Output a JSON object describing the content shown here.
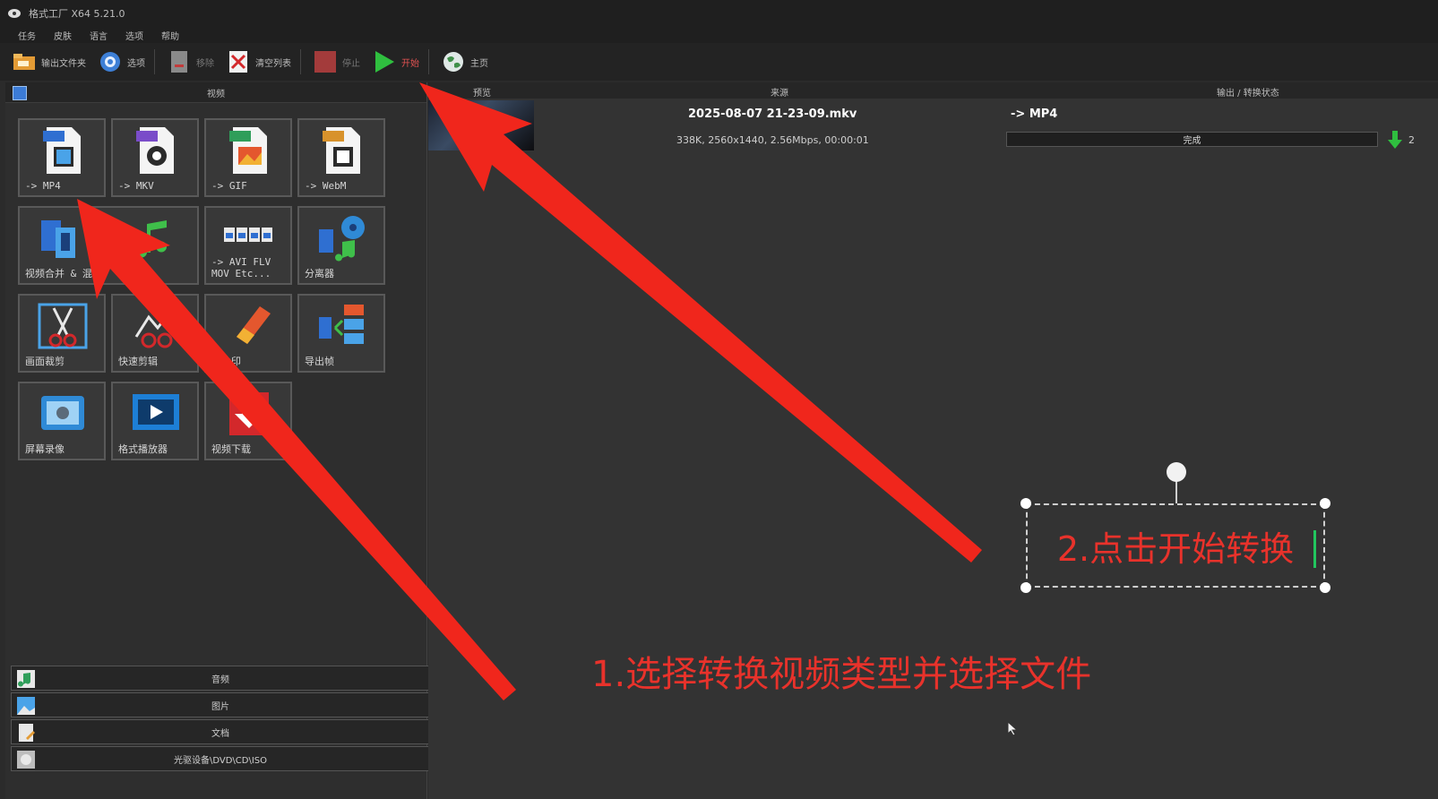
{
  "window": {
    "title": "格式工厂 X64 5.21.0"
  },
  "menu": [
    "任务",
    "皮肤",
    "语言",
    "选项",
    "帮助"
  ],
  "toolbar": {
    "output_folder": "输出文件夹",
    "options": "选项",
    "delete": "移除",
    "clear_list": "清空列表",
    "stop": "停止",
    "start": "开始",
    "home": "主页"
  },
  "left_panel": {
    "header": "视频",
    "tiles": [
      {
        "label": "-> MP4",
        "icon": "mp4-file-icon"
      },
      {
        "label": "-> MKV",
        "icon": "mkv-file-icon"
      },
      {
        "label": "-> GIF",
        "icon": "gif-file-icon"
      },
      {
        "label": "-> WebM",
        "icon": "webm-file-icon"
      },
      {
        "label": "视频合并 & 混流",
        "icon": "merge-icon"
      },
      {
        "label": "-> AVI FLV\nMOV Etc...",
        "icon": "formats-icon"
      },
      {
        "label": "分离器",
        "icon": "separator-icon"
      },
      {
        "label": "画面裁剪",
        "icon": "crop-scissors-icon"
      },
      {
        "label": "快速剪辑",
        "icon": "quick-clip-icon"
      },
      {
        "label": "去水印",
        "icon": "eraser-icon"
      },
      {
        "label": "导出帧",
        "icon": "export-frames-icon"
      },
      {
        "label": "屏幕录像",
        "icon": "screen-record-icon"
      },
      {
        "label": "格式播放器",
        "icon": "player-icon"
      },
      {
        "label": "视频下载",
        "icon": "video-download-icon"
      }
    ],
    "categories": [
      "音频",
      "图片",
      "文档",
      "光驱设备\\DVD\\CD\\ISO"
    ]
  },
  "task_list": {
    "columns": {
      "preview": "预览",
      "source": "来源",
      "output": "输出 / 转换状态"
    },
    "item": {
      "filename": "2025-08-07 21-23-09.mkv",
      "info": "338K, 2560x1440, 2.56Mbps, 00:00:01",
      "target": "-> MP4",
      "status": "完成",
      "edge_text": "2"
    }
  },
  "annotations": {
    "note1": "1.选择转换视频类型并选择文件",
    "note2": "2.点击开始转换",
    "color": "#e8322b"
  },
  "colors": {
    "accent_green": "#22c55e",
    "annotation_red": "#e8322b"
  }
}
